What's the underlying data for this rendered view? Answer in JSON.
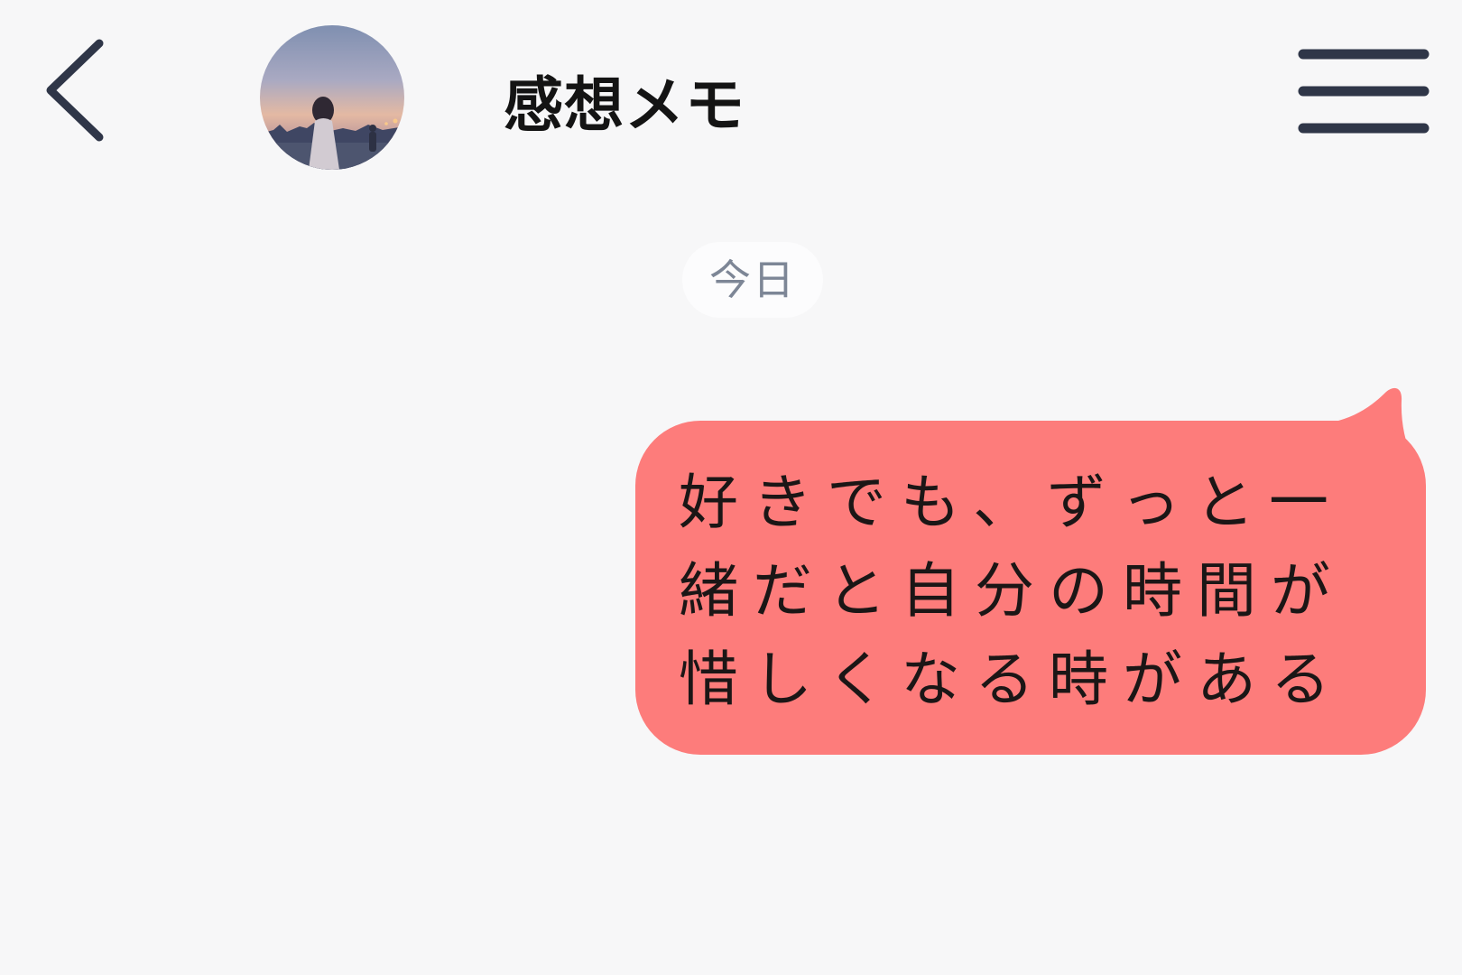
{
  "header": {
    "title": "感想メモ",
    "back_icon": "chevron-left-icon",
    "menu_icon": "hamburger-menu-icon",
    "icon_color": "#2f3648"
  },
  "chat": {
    "date_label": "今日",
    "messages": [
      {
        "sender": "self",
        "text": "好きでも、ずっと一緒だと自分の時間が惜しくなる時がある",
        "bubble_color": "#fd7c7b"
      }
    ]
  },
  "colors": {
    "background": "#f7f7f8",
    "title_text": "#141414",
    "date_text": "#7d8696"
  }
}
